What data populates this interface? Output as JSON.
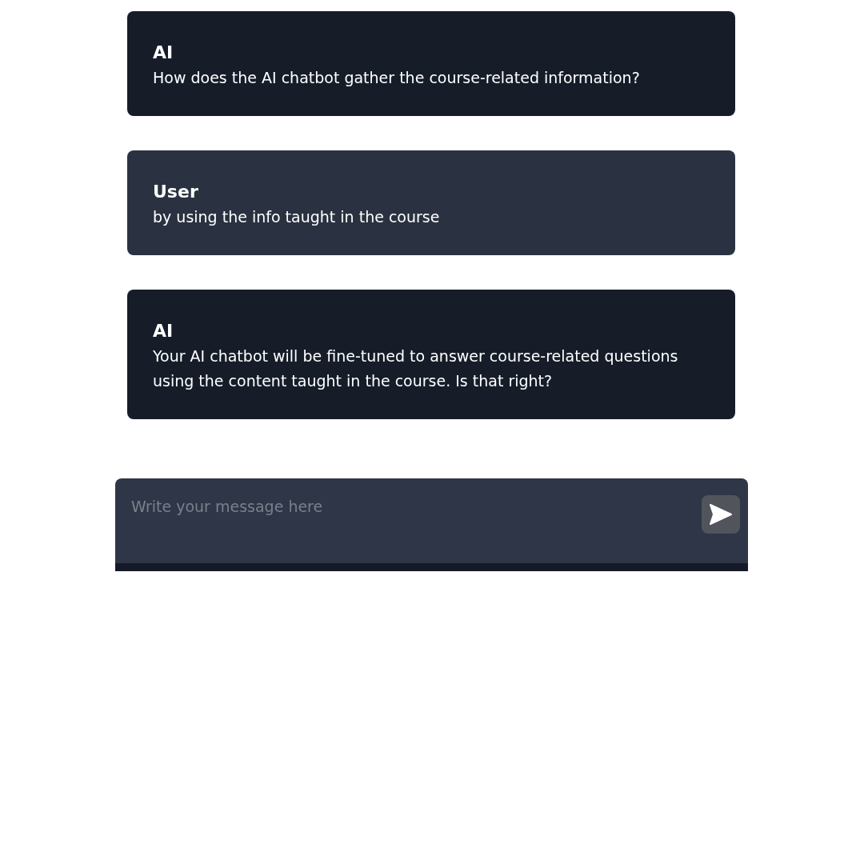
{
  "messages": [
    {
      "kind": "ai",
      "sender": "AI",
      "text": "How does the AI chatbot gather the course-related information?"
    },
    {
      "kind": "user",
      "sender": "User",
      "text": "by using the info taught in the course"
    },
    {
      "kind": "ai",
      "sender": "AI",
      "text": "Your AI chatbot will be fine-tuned to answer course-related questions using the content taught in the course. Is that right?"
    }
  ],
  "composer": {
    "placeholder": "Write your message here"
  }
}
